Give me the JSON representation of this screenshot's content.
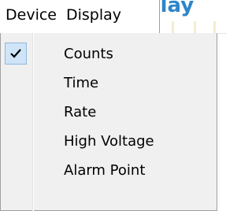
{
  "background_heading": "play",
  "menubar": {
    "device_label": "Device",
    "display_label": "Display"
  },
  "dropdown": {
    "items": [
      {
        "label": "Counts",
        "checked": true
      },
      {
        "label": "Time",
        "checked": false
      },
      {
        "label": "Rate",
        "checked": false
      },
      {
        "label": "High Voltage",
        "checked": false
      },
      {
        "label": "Alarm Point",
        "checked": false
      }
    ]
  },
  "colors": {
    "heading_blue": "#2e86c8",
    "check_highlight": "#cfe4f6",
    "menu_background": "#f0f0f0"
  },
  "icons": {
    "checkmark": "check-icon"
  }
}
